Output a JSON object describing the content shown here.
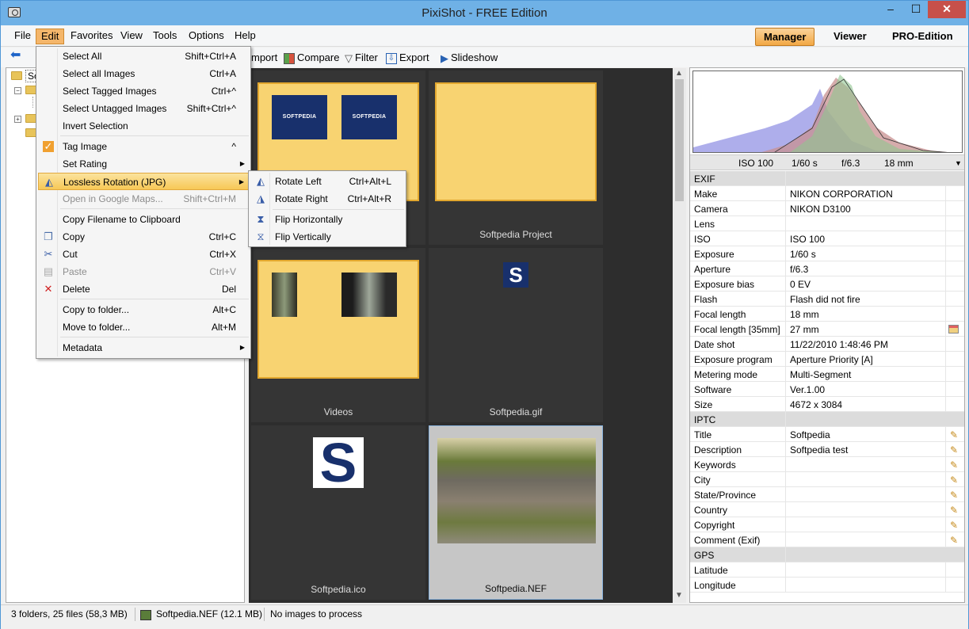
{
  "window": {
    "title": "PixiShot  -  FREE Edition",
    "min": "–",
    "max": "☐",
    "close": "✕"
  },
  "menubar": {
    "file": "File",
    "edit": "Edit",
    "favorites": "Favorites",
    "view": "View",
    "tools": "Tools",
    "options": "Options",
    "help": "Help"
  },
  "modes": {
    "manager": "Manager",
    "viewer": "Viewer",
    "pro": "PRO-Edition"
  },
  "toolbar": {
    "import": "mport",
    "compare": "Compare",
    "filter": "Filter",
    "export": "Export",
    "slideshow": "Slideshow"
  },
  "tree": {
    "root_label": "So"
  },
  "edit_menu": [
    {
      "label": "Select All",
      "shortcut": "Shift+Ctrl+A"
    },
    {
      "label": "Select all Images",
      "shortcut": "Ctrl+A"
    },
    {
      "label": "Select Tagged Images",
      "shortcut": "Ctrl+^"
    },
    {
      "label": "Select Untagged Images",
      "shortcut": "Shift+Ctrl+^"
    },
    {
      "label": "Invert Selection",
      "shortcut": ""
    },
    {
      "label": "Tag Image",
      "shortcut": "^"
    },
    {
      "label": "Set Rating",
      "shortcut": ""
    },
    {
      "label": "Lossless Rotation (JPG)",
      "shortcut": ""
    },
    {
      "label": "Open in Google Maps...",
      "shortcut": "Shift+Ctrl+M"
    },
    {
      "label": "Copy Filename to Clipboard",
      "shortcut": ""
    },
    {
      "label": "Copy",
      "shortcut": "Ctrl+C"
    },
    {
      "label": "Cut",
      "shortcut": "Ctrl+X"
    },
    {
      "label": "Paste",
      "shortcut": "Ctrl+V"
    },
    {
      "label": "Delete",
      "shortcut": "Del"
    },
    {
      "label": "Copy to folder...",
      "shortcut": "Alt+C"
    },
    {
      "label": "Move to folder...",
      "shortcut": "Alt+M"
    },
    {
      "label": "Metadata",
      "shortcut": ""
    }
  ],
  "rotation_submenu": [
    {
      "label": "Rotate Left",
      "shortcut": "Ctrl+Alt+L"
    },
    {
      "label": "Rotate Right",
      "shortcut": "Ctrl+Alt+R"
    },
    {
      "label": "Flip Horizontally",
      "shortcut": ""
    },
    {
      "label": "Flip Vertically",
      "shortcut": ""
    }
  ],
  "thumbnails": [
    {
      "label": ""
    },
    {
      "label": "Softpedia Project"
    },
    {
      "label": "Videos"
    },
    {
      "label": "Softpedia.gif"
    },
    {
      "label": "Softpedia.ico"
    },
    {
      "label": "Softpedia.NEF"
    }
  ],
  "thumb_text": {
    "softpedia_logo": "SOFTPEDIA",
    "s_glyph": "S"
  },
  "histogram": {
    "iso": "ISO 100",
    "shutter": "1/60 s",
    "aperture": "f/6.3",
    "focal": "18 mm"
  },
  "sections": {
    "exif": "EXIF",
    "iptc": "IPTC",
    "gps": "GPS"
  },
  "exif": [
    {
      "k": "Make",
      "v": "NIKON CORPORATION"
    },
    {
      "k": "Camera",
      "v": "NIKON D3100"
    },
    {
      "k": "Lens",
      "v": ""
    },
    {
      "k": "ISO",
      "v": "ISO 100"
    },
    {
      "k": "Exposure",
      "v": "1/60 s"
    },
    {
      "k": "Aperture",
      "v": "f/6.3"
    },
    {
      "k": "Exposure bias",
      "v": "0 EV"
    },
    {
      "k": "Flash",
      "v": "Flash did not fire"
    },
    {
      "k": "Focal length",
      "v": "18 mm"
    },
    {
      "k": "Focal length [35mm]",
      "v": "27 mm"
    },
    {
      "k": "Date shot",
      "v": "11/22/2010 1:48:46 PM"
    },
    {
      "k": "Exposure program",
      "v": "Aperture Priority [A]"
    },
    {
      "k": "Metering mode",
      "v": "Multi-Segment"
    },
    {
      "k": "Software",
      "v": "Ver.1.00"
    },
    {
      "k": "Size",
      "v": "4672 x 3084"
    }
  ],
  "iptc": [
    {
      "k": "Title",
      "v": "Softpedia"
    },
    {
      "k": "Description",
      "v": "Softpedia test"
    },
    {
      "k": "Keywords",
      "v": ""
    },
    {
      "k": "City",
      "v": ""
    },
    {
      "k": "State/Province",
      "v": ""
    },
    {
      "k": "Country",
      "v": ""
    },
    {
      "k": "Copyright",
      "v": ""
    },
    {
      "k": "Comment (Exif)",
      "v": ""
    }
  ],
  "gps": [
    {
      "k": "Latitude",
      "v": ""
    },
    {
      "k": "Longitude",
      "v": ""
    }
  ],
  "status": {
    "counts": "3 folders,  25 files  (58,3 MB)",
    "file": "Softpedia.NEF  (12.1 MB)",
    "process": "No images to process"
  }
}
